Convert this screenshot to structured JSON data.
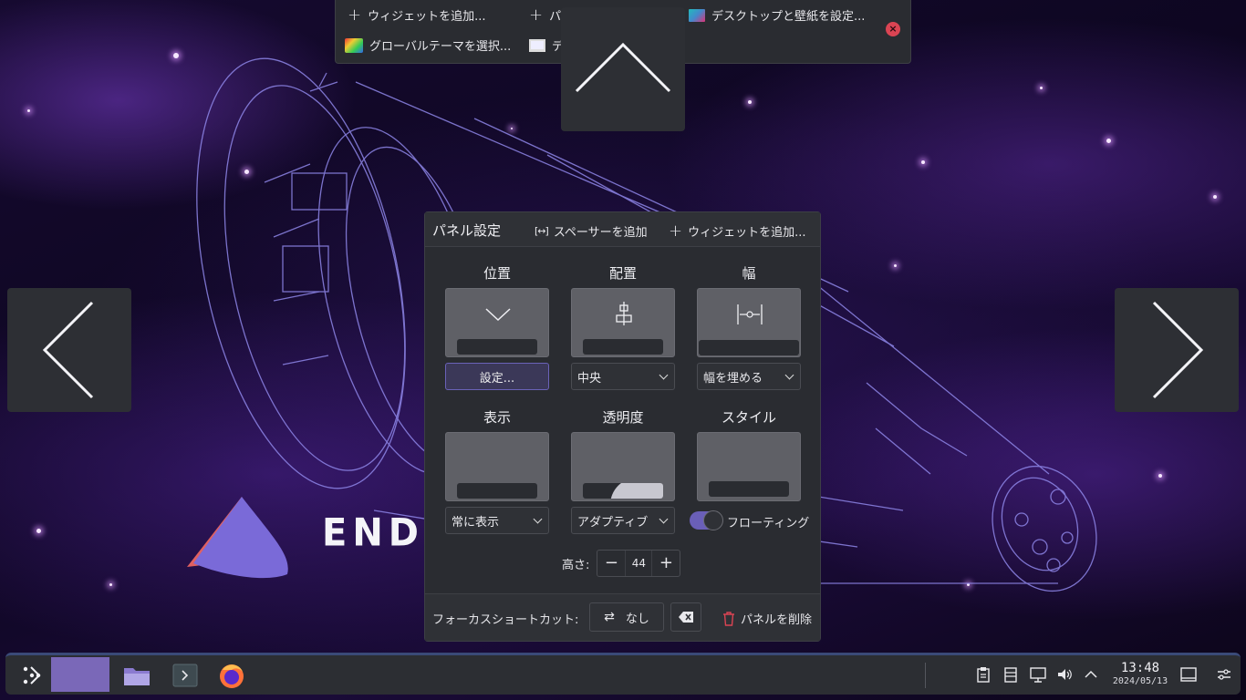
{
  "top_toolbar": {
    "add_widget": "ウィジェットを追加...",
    "add_panel": "パ",
    "desktop_wallpaper": "デスクトップと壁紙を設定...",
    "global_theme": "グローバルテーマを選択...",
    "display": "デ"
  },
  "desktop": {
    "logo_text": "ENDEA"
  },
  "panel_settings": {
    "title": "パネル設定",
    "add_spacer": "スペーサーを追加",
    "add_widget": "ウィジェットを追加...",
    "position": {
      "label": "位置",
      "button": "設定..."
    },
    "alignment": {
      "label": "配置",
      "value": "中央"
    },
    "width": {
      "label": "幅",
      "value": "幅を埋める"
    },
    "visibility": {
      "label": "表示",
      "value": "常に表示"
    },
    "opacity": {
      "label": "透明度",
      "value": "アダプティブ"
    },
    "style": {
      "label": "スタイル",
      "toggle_label": "フローティング",
      "floating": true
    },
    "height": {
      "label": "高さ:",
      "value": "44"
    },
    "focus_shortcut": {
      "label": "フォーカスショートカット:",
      "value": "なし"
    },
    "delete_panel": "パネルを削除"
  },
  "taskbar": {
    "time": "13:48",
    "date": "2024/05/13"
  },
  "colors": {
    "accent": "#7a68b8",
    "danger": "#da4453",
    "panel_bg": "#2a2c31"
  }
}
